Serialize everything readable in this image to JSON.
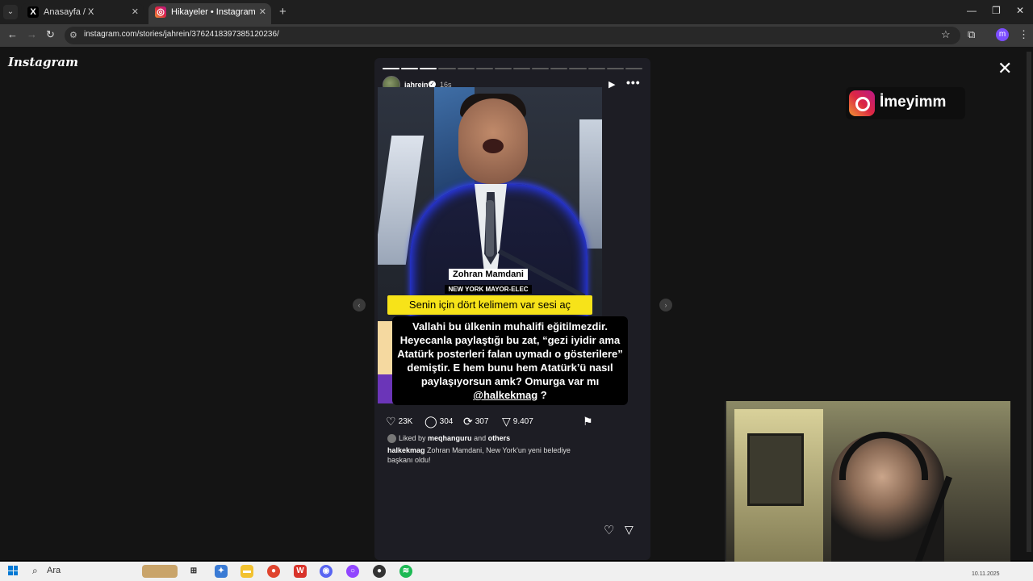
{
  "browser": {
    "tabs": [
      {
        "title": "Anasayfa / X",
        "icon": "x-logo-icon",
        "active": false
      },
      {
        "title": "Hikayeler • Instagram",
        "icon": "instagram-icon",
        "active": true
      }
    ],
    "url": "instagram.com/stories/jahrein/3762418397385120236/",
    "profile_initial": "m"
  },
  "instagram": {
    "logo_text": "Instagram",
    "story": {
      "username": "jahrein",
      "time": "16s",
      "progress": {
        "total_segments": 14,
        "completed_segments": 3
      },
      "nameplate_name": "Zohran Mamdani",
      "nameplate_title": "NEW YORK MAYOR-ELEC",
      "yellow_caption": "Senin için dört kelimem var sesi aç",
      "main_caption": "Vallahi bu ülkenin muhalifi eğitilmezdir. Heyecanla paylaştığı bu zat, “gezi iyidir ama Atatürk posterleri falan uymadı o gösterilere” demiştir. E hem bunu hem Atatürk’ü nasıl paylaşıyorsun amk? Omurga var mı",
      "main_caption_mention": "@halkekmag",
      "main_caption_end": "?",
      "likes": "23K",
      "comments": "304",
      "reposts": "307",
      "shares": "9.407",
      "liked_by_prefix": "Liked by",
      "liked_by_user": "meqhanguru",
      "liked_by_and": "and",
      "liked_by_others": "others",
      "caption_user": "halkekmag",
      "caption_text": "Zohran Mamdani, New York'un yeni belediye başkanı oldu!"
    }
  },
  "overlay": {
    "handle": "İmeyimm"
  },
  "taskbar": {
    "search_label": "Ara",
    "date": "10.11.2025"
  },
  "colors": {
    "caption_yellow": "#f7e319",
    "page_bg": "#141414",
    "story_bg": "#1d1d24"
  }
}
